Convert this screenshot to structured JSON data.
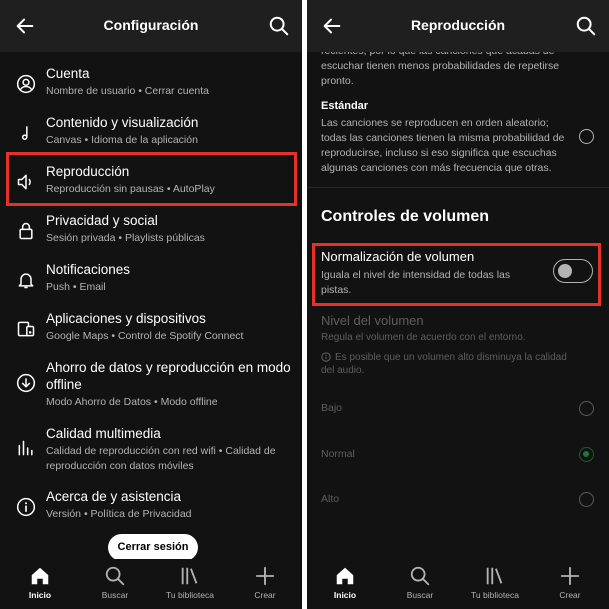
{
  "left": {
    "title": "Configuración",
    "items": [
      {
        "label": "Cuenta",
        "sub": "Nombre de usuario • Cerrar cuenta",
        "icon": "user-circle-icon"
      },
      {
        "label": "Contenido y visualización",
        "sub": "Canvas • Idioma de la aplicación",
        "icon": "music-note-icon"
      },
      {
        "label": "Reproducción",
        "sub": "Reproducción sin pausas • AutoPlay",
        "icon": "speaker-icon"
      },
      {
        "label": "Privacidad y social",
        "sub": "Sesión privada • Playlists públicas",
        "icon": "lock-icon"
      },
      {
        "label": "Notificaciones",
        "sub": "Push • Email",
        "icon": "bell-icon"
      },
      {
        "label": "Aplicaciones y dispositivos",
        "sub": "Google Maps • Control de Spotify Connect",
        "icon": "devices-icon"
      },
      {
        "label1": "Ahorro de datos y reproducción en modo",
        "label2": "offline",
        "sub": "Modo Ahorro de Datos • Modo offline",
        "icon": "download-circle-icon"
      },
      {
        "label": "Calidad multimedia",
        "sub1": "Calidad de reproducción con red wifi • Calidad de",
        "sub2": "reproducción con datos móviles",
        "icon": "bars-icon"
      },
      {
        "label": "Acerca de y asistencia",
        "sub": "Versión • Política de Privacidad",
        "icon": "info-icon"
      }
    ],
    "logout_label": "Cerrar sesión"
  },
  "right": {
    "title": "Reproducción",
    "top_text": [
      "recientes, por lo que las canciones que acabas de",
      "escuchar tienen menos probabilidades de repetirse",
      "pronto."
    ],
    "estandar_label": "Estándar",
    "estandar_text": [
      "Las canciones se reproducen en orden aleatorio;",
      "todas las canciones tienen la misma probabilidad de",
      "reproducirse, incluso si eso significa que escuchas",
      "algunas canciones con más frecuencia que otras."
    ],
    "section_title": "Controles de volumen",
    "norm_label": "Normalización de volumen",
    "norm_text": [
      "Iguala el nivel de intensidad de todas las",
      "pistas."
    ],
    "norm_enabled": false,
    "level_label": "Nivel del volumen",
    "level_desc": "Regula el volumen de acuerdo con el entorno.",
    "warning": [
      "Es posible que un volumen alto disminuya la calidad",
      "del audio."
    ],
    "options": [
      {
        "label": "Bajo",
        "selected": false
      },
      {
        "label": "Normal",
        "selected": true
      },
      {
        "label": "Alto",
        "selected": false
      }
    ]
  },
  "nav": {
    "home": "Inicio",
    "search": "Buscar",
    "library": "Tu biblioteca",
    "create": "Crear"
  },
  "colors": {
    "highlight": "#e53228",
    "background": "#121212",
    "header": "#1f1f1f",
    "accent_green": "#1b7a3a"
  }
}
